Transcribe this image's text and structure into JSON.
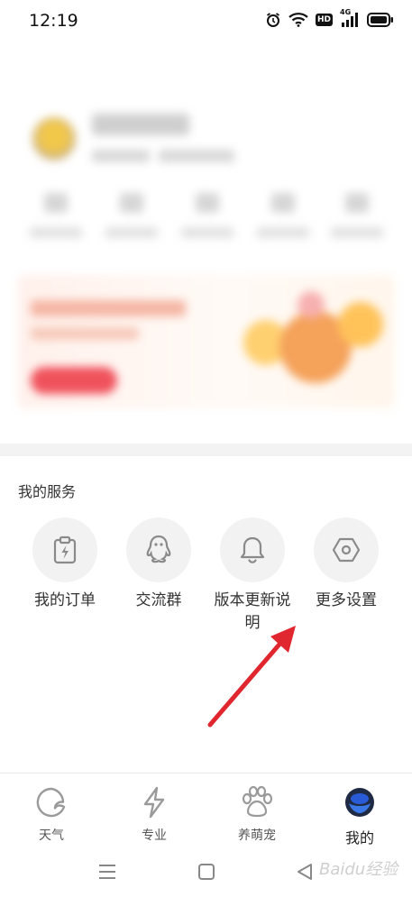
{
  "status_bar": {
    "time": "12:19",
    "hd_label": "HD",
    "network_label": "4G"
  },
  "services": {
    "title": "我的服务",
    "items": [
      {
        "label": "我的订单",
        "icon": "order-icon"
      },
      {
        "label": "交流群",
        "icon": "qq-penguin-icon"
      },
      {
        "label": "版本更新说明",
        "icon": "bell-icon"
      },
      {
        "label": "更多设置",
        "icon": "settings-hexagon-icon"
      }
    ]
  },
  "bottom_nav": {
    "items": [
      {
        "label": "天气",
        "icon": "weather-icon"
      },
      {
        "label": "专业",
        "icon": "lightning-icon"
      },
      {
        "label": "养萌宠",
        "icon": "paw-icon"
      },
      {
        "label": "我的",
        "icon": "profile-face-icon",
        "active": true
      }
    ]
  },
  "watermark": "Baidu经验",
  "colors": {
    "accent_blue": "#2a5bd7",
    "arrow_red": "#e0262e",
    "icon_gray": "#8a8a8a"
  }
}
